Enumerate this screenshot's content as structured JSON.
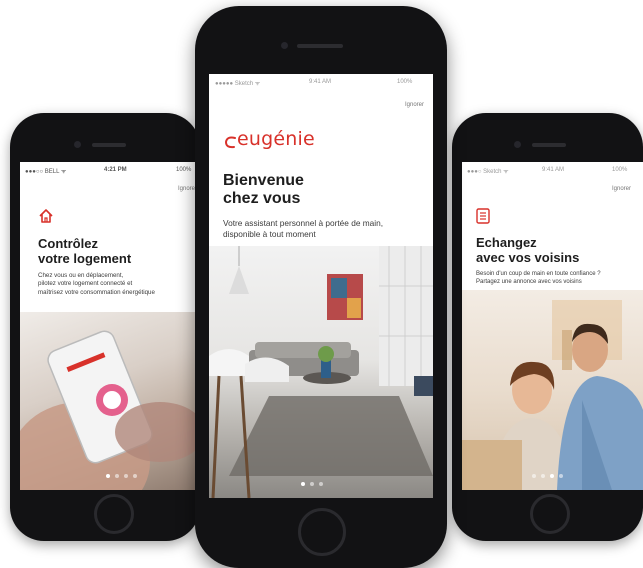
{
  "left_screen": {
    "status_carrier": "●●●○○ BELL ᯤ",
    "status_time": "4:21 PM",
    "status_battery": "100%",
    "skip_label": "Ignorer",
    "icon": "home-icon",
    "title_line1": "Contrôlez",
    "title_line2": "votre logement",
    "desc_line1": "Chez vous ou en déplacement,",
    "desc_line2": "pilotez votre logement connecté et",
    "desc_line3": "maîtrisez votre consommation énergétique"
  },
  "center_screen": {
    "status_carrier": "●●●●● Sketch ᯤ",
    "status_time": "9:41 AM",
    "status_battery": "100%",
    "skip_label": "Ignorer",
    "logo_text": "eugénie",
    "title_line1": "Bienvenue",
    "title_line2": "chez vous",
    "desc_line1": "Votre assistant personnel à portée de main,",
    "desc_line2": "disponible à tout moment"
  },
  "right_screen": {
    "status_carrier": "●●●○ Sketch ᯤ",
    "status_time": "9:41 AM",
    "status_battery": "100%",
    "skip_label": "Ignorer",
    "icon": "message-board-icon",
    "title_line1": "Echangez",
    "title_line2": "avec vos voisins",
    "desc_line1": "Besoin d'un coup de main en toute confiance ?",
    "desc_line2": "Partagez une annonce avec vos voisins"
  },
  "colors": {
    "brand_red": "#d8312a",
    "phone_body": "#121214",
    "text_dark": "#1e1e1e"
  }
}
